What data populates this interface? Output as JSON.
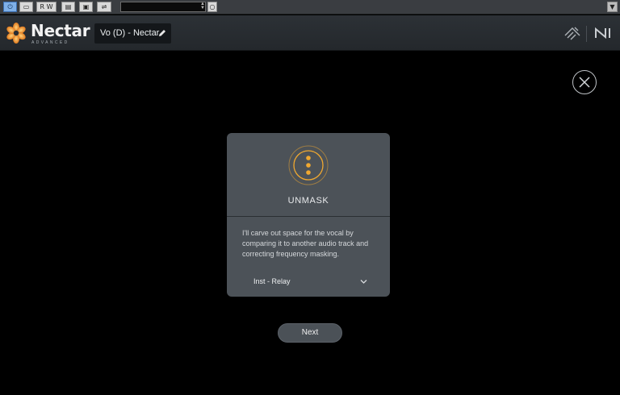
{
  "host_toolbar": {
    "buttons": [
      {
        "name": "power",
        "label": "⏻"
      },
      {
        "name": "compare",
        "label": "▭"
      },
      {
        "name": "read-write",
        "label": "R W"
      },
      {
        "name": "preset",
        "label": "▤"
      },
      {
        "name": "settings",
        "label": "▣"
      },
      {
        "name": "routing",
        "label": "⇌"
      }
    ],
    "preset_field_value": ""
  },
  "header": {
    "brand": "Nectar",
    "brand_sub": "ADVANCED",
    "preset_name": "Vo (D) - Nectar"
  },
  "assistant": {
    "title": "UNMASK",
    "description": "I'll carve out space for the vocal by comparing it to another audio track and correcting frequency masking.",
    "track_select": {
      "value": "Inst - Relay"
    },
    "next_label": "Next"
  },
  "colors": {
    "accent": "#f0a830",
    "background": "#000000",
    "card": "#4c5258",
    "header": "#2a2e33"
  }
}
